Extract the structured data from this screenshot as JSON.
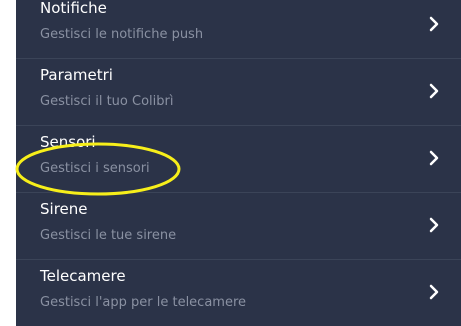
{
  "colors": {
    "panel_background": "#2b3348",
    "title_text": "#ffffff",
    "subtitle_text": "#8a91a2",
    "highlight_ellipse": "#f7ef1a"
  },
  "menu": {
    "items": [
      {
        "title": "Notifiche",
        "subtitle": "Gestisci le notifiche push",
        "icon": "chevron-right-icon"
      },
      {
        "title": "Parametri",
        "subtitle": "Gestisci il tuo Colibrì",
        "icon": "chevron-right-icon"
      },
      {
        "title": "Sensori",
        "subtitle": "Gestisci i sensori",
        "icon": "chevron-right-icon"
      },
      {
        "title": "Sirene",
        "subtitle": "Gestisci le tue sirene",
        "icon": "chevron-right-icon"
      },
      {
        "title": "Telecamere",
        "subtitle": "Gestisci l'app per le telecamere",
        "icon": "chevron-right-icon"
      }
    ]
  },
  "annotation": {
    "type": "highlight-ellipse",
    "target": "Sensori"
  }
}
